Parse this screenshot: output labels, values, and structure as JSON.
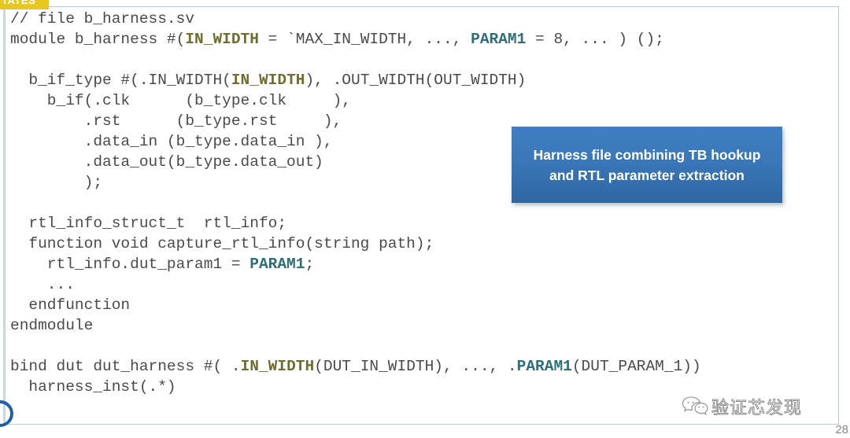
{
  "ribbon": {
    "badge_label": "TATES",
    "badge_color": "#e8c81e"
  },
  "code": {
    "language": "systemverilog",
    "colors": {
      "text": "#4a4a4a",
      "param_olive": "#6e6e2f",
      "param_teal": "#2e6e77",
      "box_border": "#b9cbd6",
      "box_accent": "#c7d8e2"
    },
    "lines": [
      [
        {
          "t": "// file b_harness.sv",
          "c": "plain"
        }
      ],
      [
        {
          "t": "module b_harness #(",
          "c": "plain"
        },
        {
          "t": "IN_WIDTH",
          "c": "olive"
        },
        {
          "t": " = `MAX_IN_WIDTH, ..., ",
          "c": "plain"
        },
        {
          "t": "PARAM1",
          "c": "teal"
        },
        {
          "t": " = 8, ... ) ();",
          "c": "plain"
        }
      ],
      [
        {
          "t": "",
          "c": "plain"
        }
      ],
      [
        {
          "t": "  b_if_type #(.IN_WIDTH(",
          "c": "plain"
        },
        {
          "t": "IN_WIDTH",
          "c": "olive"
        },
        {
          "t": "), .OUT_WIDTH(OUT_WIDTH)",
          "c": "plain"
        }
      ],
      [
        {
          "t": "    b_if(.clk      (b_type.clk     ),",
          "c": "plain"
        }
      ],
      [
        {
          "t": "        .rst      (b_type.rst     ),",
          "c": "plain"
        }
      ],
      [
        {
          "t": "        .data_in (b_type.data_in ),",
          "c": "plain"
        }
      ],
      [
        {
          "t": "        .data_out(b_type.data_out)",
          "c": "plain"
        }
      ],
      [
        {
          "t": "        );",
          "c": "plain"
        }
      ],
      [
        {
          "t": "",
          "c": "plain"
        }
      ],
      [
        {
          "t": "  rtl_info_struct_t  rtl_info;",
          "c": "plain"
        }
      ],
      [
        {
          "t": "  function void capture_rtl_info(string path);",
          "c": "plain"
        }
      ],
      [
        {
          "t": "    rtl_info.dut_param1 = ",
          "c": "plain"
        },
        {
          "t": "PARAM1",
          "c": "teal"
        },
        {
          "t": ";",
          "c": "plain"
        }
      ],
      [
        {
          "t": "    ...",
          "c": "plain"
        }
      ],
      [
        {
          "t": "  endfunction",
          "c": "plain"
        }
      ],
      [
        {
          "t": "endmodule",
          "c": "plain"
        }
      ],
      [
        {
          "t": "",
          "c": "plain"
        }
      ],
      [
        {
          "t": "bind dut dut_harness #( .",
          "c": "plain"
        },
        {
          "t": "IN_WIDTH",
          "c": "olive"
        },
        {
          "t": "(DUT_IN_WIDTH), ..., .",
          "c": "plain"
        },
        {
          "t": "PARAM1",
          "c": "teal"
        },
        {
          "t": "(DUT_PARAM_1))",
          "c": "plain"
        }
      ],
      [
        {
          "t": "  harness_inst(.*)",
          "c": "plain"
        }
      ]
    ]
  },
  "callout": {
    "text": "Harness file combining TB hookup and RTL parameter extraction",
    "line1": "Harness file combining TB hookup",
    "line2": "and RTL parameter extraction",
    "background_color": "#3a77b9",
    "text_color": "#ffffff"
  },
  "footer": {
    "page_number": "28"
  },
  "watermark": {
    "icon": "wechat-icon",
    "text": "验证芯发现"
  }
}
